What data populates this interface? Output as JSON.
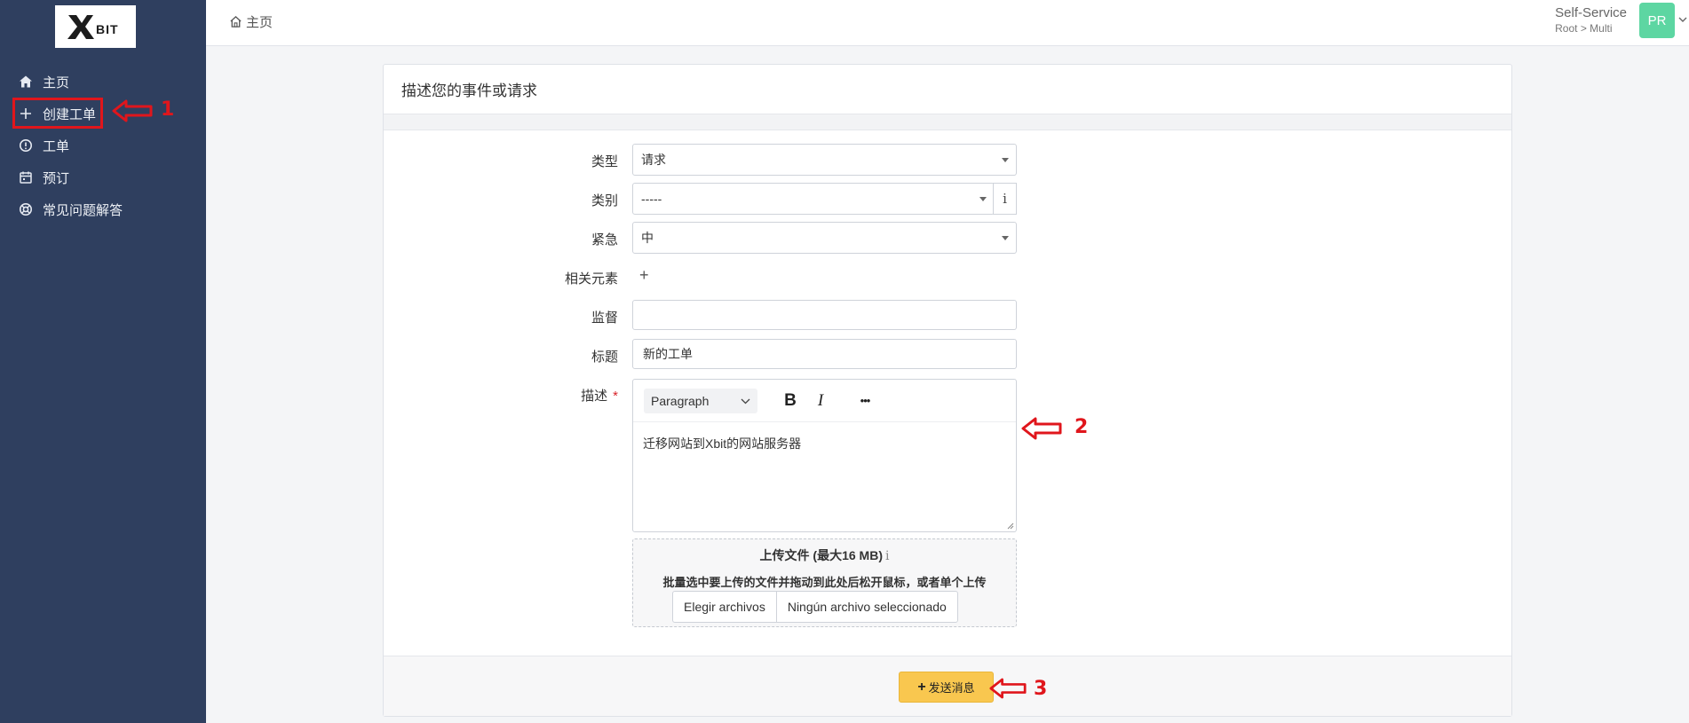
{
  "brand": {
    "logo_text": "XBIT"
  },
  "sidebar": {
    "items": [
      {
        "label": "主页",
        "icon": "home-icon"
      },
      {
        "label": "创建工单",
        "icon": "plus-icon"
      },
      {
        "label": "工单",
        "icon": "alert-circle-icon"
      },
      {
        "label": "预订",
        "icon": "calendar-icon"
      },
      {
        "label": "常见问题解答",
        "icon": "lifebuoy-icon"
      }
    ]
  },
  "header": {
    "breadcrumb": "主页",
    "user_name": "Self-Service",
    "user_path": "Root > Multi",
    "avatar_initials": "PR"
  },
  "form": {
    "title": "描述您的事件或请求",
    "fields": {
      "type": {
        "label": "类型",
        "value": "请求"
      },
      "category": {
        "label": "类别",
        "value": "-----",
        "info": "i"
      },
      "urgency": {
        "label": "紧急",
        "value": "中"
      },
      "related": {
        "label": "相关元素",
        "add": "+"
      },
      "observer": {
        "label": "监督",
        "value": ""
      },
      "title": {
        "label": "标题",
        "value": "新的工单"
      },
      "description": {
        "label": "描述",
        "required": "*",
        "format": "Paragraph",
        "bold": "B",
        "italic": "I",
        "more": "•••",
        "content": "迁移网站到Xbit的网站服务器"
      }
    },
    "upload": {
      "title": "上传文件 (最大16 MB)",
      "info": "i",
      "hint": "批量选中要上传的文件并拖动到此处后松开鼠标，或者单个上传",
      "choose_label": "Elegir archivos",
      "status": "Ningún archivo seleccionado"
    },
    "submit_label": "发送消息"
  },
  "annotations": {
    "a1": "1",
    "a2": "2",
    "a3": "3"
  },
  "colors": {
    "sidebar_bg": "#2f3f5f",
    "accent_yellow": "#f9c74f",
    "annotation_red": "#e0161c",
    "avatar_green": "#5dd6a2"
  }
}
